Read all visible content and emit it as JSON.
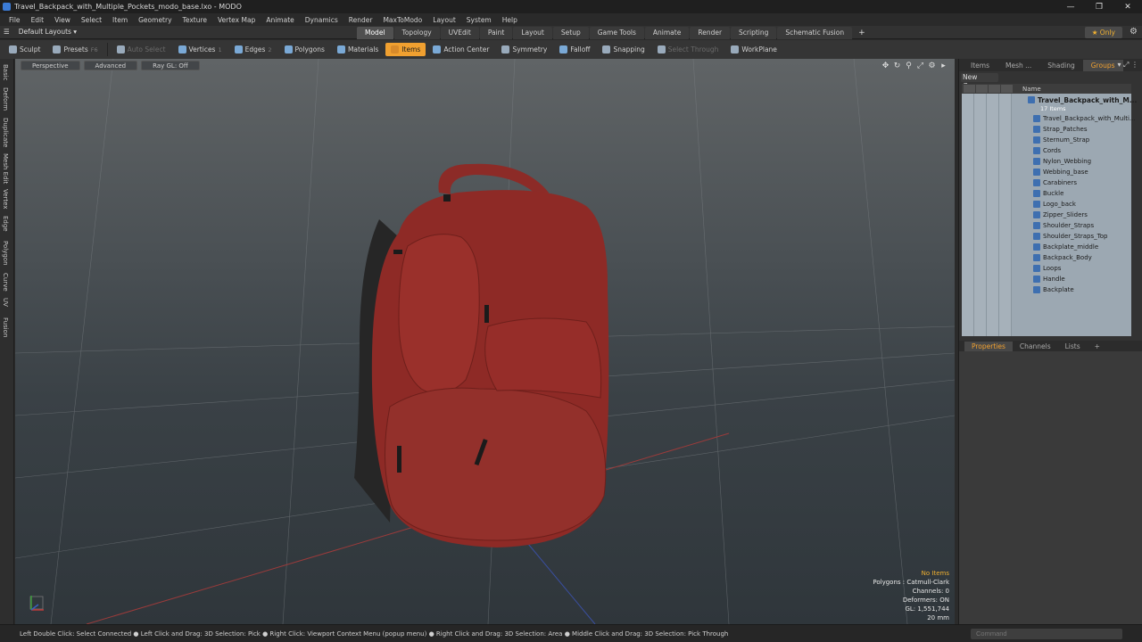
{
  "window": {
    "title": "Travel_Backpack_with_Multiple_Pockets_modo_base.lxo - MODO",
    "controls": [
      "—",
      "❐",
      "✕"
    ]
  },
  "menu": [
    "File",
    "Edit",
    "View",
    "Select",
    "Item",
    "Geometry",
    "Texture",
    "Vertex Map",
    "Animate",
    "Dynamics",
    "Render",
    "MaxToModo",
    "Layout",
    "System",
    "Help"
  ],
  "layout_bar": {
    "layouts_label": "Default Layouts ▾",
    "tabs": [
      "Model",
      "Topology",
      "UVEdit",
      "Paint",
      "Layout",
      "Setup",
      "Game Tools",
      "Animate",
      "Render",
      "Scripting",
      "Schematic Fusion"
    ],
    "active_tab": "Model",
    "add_tab": "+",
    "only_label": "★ Only",
    "settings_icon": "⚙"
  },
  "toolbar": {
    "sculpt": "Sculpt",
    "presets": "Presets",
    "presets_key": "F6",
    "auto_select": "Auto Select",
    "vertices": "Vertices",
    "vertices_key": "1",
    "edges": "Edges",
    "edges_key": "2",
    "polygons": "Polygons",
    "materials": "Materials",
    "items": "Items",
    "action_center": "Action Center",
    "symmetry": "Symmetry",
    "falloff": "Falloff",
    "snapping": "Snapping",
    "select_through": "Select Through",
    "workplane": "WorkPlane"
  },
  "left_tabs": [
    "Basic",
    "Deform",
    "Duplicate",
    "Mesh Edit",
    "Vertex",
    "Edge",
    "Polygon",
    "Curve",
    "UV",
    "Fusion"
  ],
  "viewport": {
    "header": [
      "Perspective",
      "Advanced",
      "Ray GL: Off"
    ],
    "stats": {
      "selection": "No Items",
      "polygons": "Polygons : Catmull-Clark",
      "channels": "Channels: 0",
      "deformers": "Deformers: ON",
      "gl": "GL: 1,551,744",
      "scale": "20 mm"
    }
  },
  "right_panel": {
    "tabs": [
      "Items",
      "Mesh ...",
      "Shading",
      "Groups"
    ],
    "active_tab": "Groups",
    "new_group": "New Group",
    "name_header": "Name",
    "root": "Travel_Backpack_with_M...",
    "root_count": "17 Items",
    "items": [
      "Travel_Backpack_with_Multi...",
      "Strap_Patches",
      "Sternum_Strap",
      "Cords",
      "Nylon_Webbing",
      "Webbing_base",
      "Carabiners",
      "Buckle",
      "Logo_back",
      "Zipper_Sliders",
      "Shoulder_Straps",
      "Shoulder_Straps_Top",
      "Backplate_middle",
      "Backpack_Body",
      "Loops",
      "Handle",
      "Backplate"
    ],
    "bottom_tabs": [
      "Properties",
      "Channels",
      "Lists",
      "+"
    ],
    "active_bottom_tab": "Properties"
  },
  "status": {
    "hint": "Left Double Click: Select Connected ● Left Click and Drag: 3D Selection: Pick ● Right Click: Viewport Context Menu (popup menu) ● Right Click and Drag: 3D Selection: Area ● Middle Click and Drag: 3D Selection: Pick Through",
    "command_placeholder": "Command"
  },
  "colors": {
    "accent": "#f0a030",
    "backpack": "#8e2a26",
    "viewport_top": "#606466",
    "viewport_bottom": "#2f363b"
  }
}
